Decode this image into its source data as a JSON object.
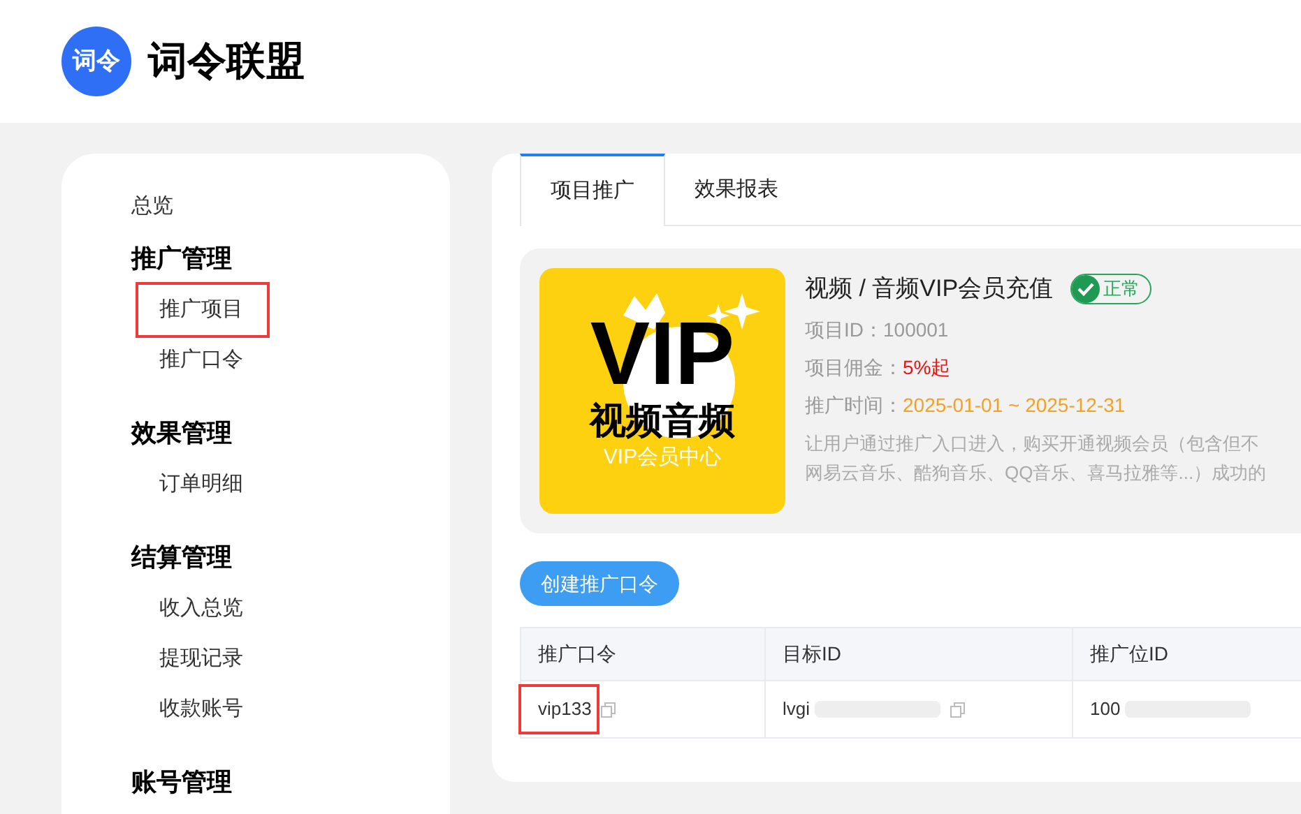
{
  "header": {
    "logo_text": "词令",
    "title": "词令联盟"
  },
  "sidebar": {
    "items": [
      {
        "kind": "link",
        "label": "总览",
        "annotated": false
      },
      {
        "kind": "group",
        "label": "推广管理",
        "children": [
          {
            "label": "推广项目",
            "annotated": true
          },
          {
            "label": "推广口令",
            "annotated": false
          }
        ]
      },
      {
        "kind": "group",
        "label": "效果管理",
        "children": [
          {
            "label": "订单明细",
            "annotated": false
          }
        ]
      },
      {
        "kind": "group",
        "label": "结算管理",
        "children": [
          {
            "label": "收入总览",
            "annotated": false
          },
          {
            "label": "提现记录",
            "annotated": false
          },
          {
            "label": "收款账号",
            "annotated": false
          }
        ]
      },
      {
        "kind": "group",
        "label": "账号管理"
      }
    ]
  },
  "tabs": [
    {
      "label": "项目推广",
      "selected": true
    },
    {
      "label": "效果报表",
      "selected": false
    }
  ],
  "project": {
    "banner": {
      "big": "VIP",
      "line1": "视频音频",
      "line2": "VIP会员中心"
    },
    "title": "视频 / 音频VIP会员充值",
    "status": "正常",
    "fields": [
      {
        "label": "项目ID：",
        "value": "100001",
        "kind": "plain"
      },
      {
        "label": "项目佣金：",
        "value": "5%起",
        "kind": "red"
      },
      {
        "label": "推广时间：",
        "value": "2025-01-01 ~ 2025-12-31",
        "kind": "orange"
      }
    ],
    "description": [
      "让用户通过推广入口进入，购买开通视频会员（包含但不",
      "网易云音乐、酷狗音乐、QQ音乐、喜马拉雅等...）成功的"
    ]
  },
  "create_button": "创建推广口令",
  "table": {
    "columns": [
      "推广口令",
      "目标ID",
      "推广位ID"
    ],
    "rows": [
      {
        "cells": [
          {
            "text": "vip133",
            "copy": true,
            "blurred": false,
            "annotated": true
          },
          {
            "text": "lvgi",
            "copy": true,
            "blurred": true,
            "annotated": false
          },
          {
            "text": "100",
            "copy": false,
            "blurred": true,
            "annotated": false
          }
        ]
      }
    ]
  }
}
